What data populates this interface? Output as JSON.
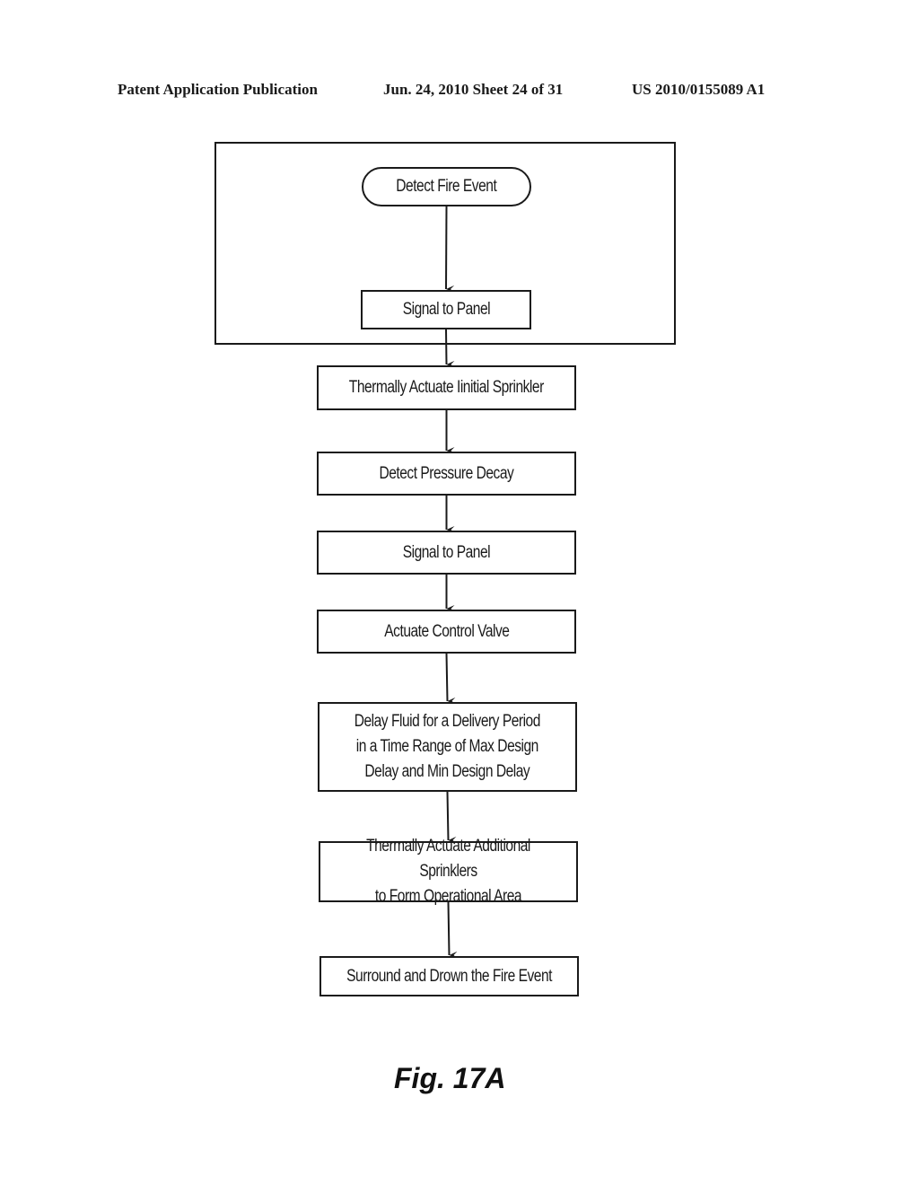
{
  "header": {
    "publication": "Patent Application Publication",
    "date_sheet": "Jun. 24, 2010  Sheet 24 of 31",
    "number": "US 2010/0155089 A1"
  },
  "flowchart": {
    "nodes": [
      {
        "id": "detect-fire-event",
        "type": "terminal",
        "label": "Detect Fire Event"
      },
      {
        "id": "signal-to-panel-1",
        "type": "process",
        "label": "Signal to Panel"
      },
      {
        "id": "thermally-actuate-initial",
        "type": "process",
        "label": "Thermally Actuate Iinitial Sprinkler"
      },
      {
        "id": "detect-pressure-decay",
        "type": "process",
        "label": "Detect Pressure Decay"
      },
      {
        "id": "signal-to-panel-2",
        "type": "process",
        "label": "Signal to Panel"
      },
      {
        "id": "actuate-control-valve",
        "type": "process",
        "label": "Actuate Control Valve"
      },
      {
        "id": "delay-fluid",
        "type": "process",
        "label": "Delay Fluid for a Delivery Period\nin a Time Range of Max Design\nDelay and Min Design Delay"
      },
      {
        "id": "thermally-actuate-additional",
        "type": "process",
        "label": "Thermally Actuate Additional Sprinklers\nto Form Operational Area"
      },
      {
        "id": "surround-drown",
        "type": "process",
        "label": "Surround and Drown the Fire Event"
      }
    ],
    "edges": [
      [
        "detect-fire-event",
        "signal-to-panel-1"
      ],
      [
        "signal-to-panel-1",
        "thermally-actuate-initial"
      ],
      [
        "thermally-actuate-initial",
        "detect-pressure-decay"
      ],
      [
        "detect-pressure-decay",
        "signal-to-panel-2"
      ],
      [
        "signal-to-panel-2",
        "actuate-control-valve"
      ],
      [
        "actuate-control-valve",
        "delay-fluid"
      ],
      [
        "delay-fluid",
        "thermally-actuate-additional"
      ],
      [
        "thermally-actuate-additional",
        "surround-drown"
      ]
    ],
    "group": {
      "label": "",
      "contains": [
        "detect-fire-event",
        "signal-to-panel-1"
      ]
    }
  },
  "figure_label": "Fig. 17A"
}
